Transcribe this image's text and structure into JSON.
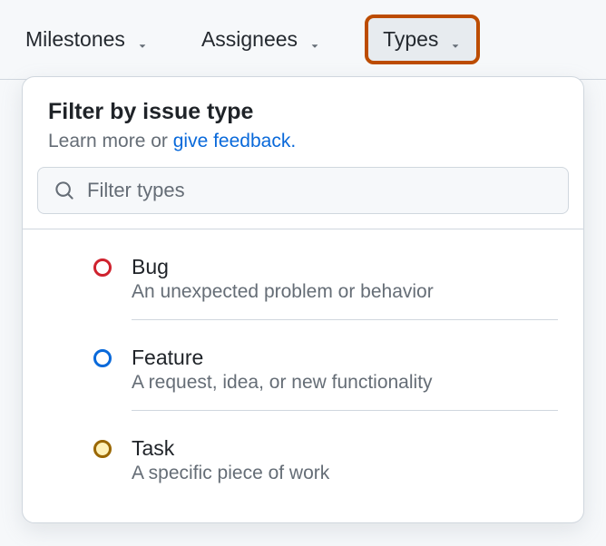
{
  "filters": {
    "milestones": {
      "label": "Milestones"
    },
    "assignees": {
      "label": "Assignees"
    },
    "types": {
      "label": "Types"
    }
  },
  "dropdown": {
    "title": "Filter by issue type",
    "subtitle_prefix": "Learn more or ",
    "subtitle_link": "give feedback.",
    "search_placeholder": "Filter types",
    "items": [
      {
        "name": "Bug",
        "description": "An unexpected problem or behavior",
        "color": "red"
      },
      {
        "name": "Feature",
        "description": "A request, idea, or new functionality",
        "color": "blue"
      },
      {
        "name": "Task",
        "description": "A specific piece of work",
        "color": "yellow"
      }
    ]
  }
}
